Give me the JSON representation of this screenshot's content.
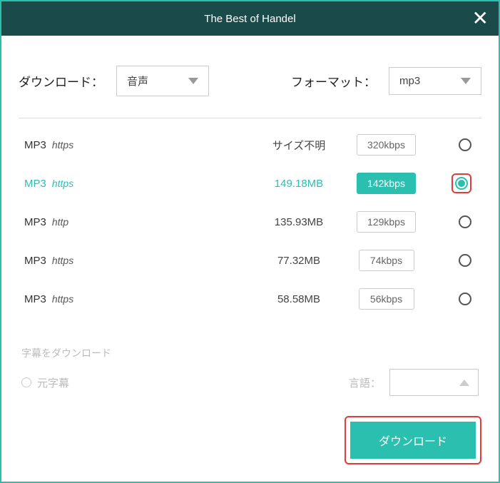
{
  "title": "The Best of Handel",
  "labels": {
    "download": "ダウンロード：",
    "format": "フォーマット：",
    "subtitle_title": "字幕をダウンロード",
    "original_subtitle": "元字幕",
    "language": "言語：",
    "download_button": "ダウンロード"
  },
  "dropdowns": {
    "download_value": "音声",
    "format_value": "mp3"
  },
  "items": [
    {
      "format": "MP3",
      "protocol": "https",
      "size": "サイズ不明",
      "bitrate": "320kbps",
      "selected": false
    },
    {
      "format": "MP3",
      "protocol": "https",
      "size": "149.18MB",
      "bitrate": "142kbps",
      "selected": true
    },
    {
      "format": "MP3",
      "protocol": "http",
      "size": "135.93MB",
      "bitrate": "129kbps",
      "selected": false
    },
    {
      "format": "MP3",
      "protocol": "https",
      "size": "77.32MB",
      "bitrate": "74kbps",
      "selected": false
    },
    {
      "format": "MP3",
      "protocol": "https",
      "size": "58.58MB",
      "bitrate": "56kbps",
      "selected": false
    }
  ]
}
